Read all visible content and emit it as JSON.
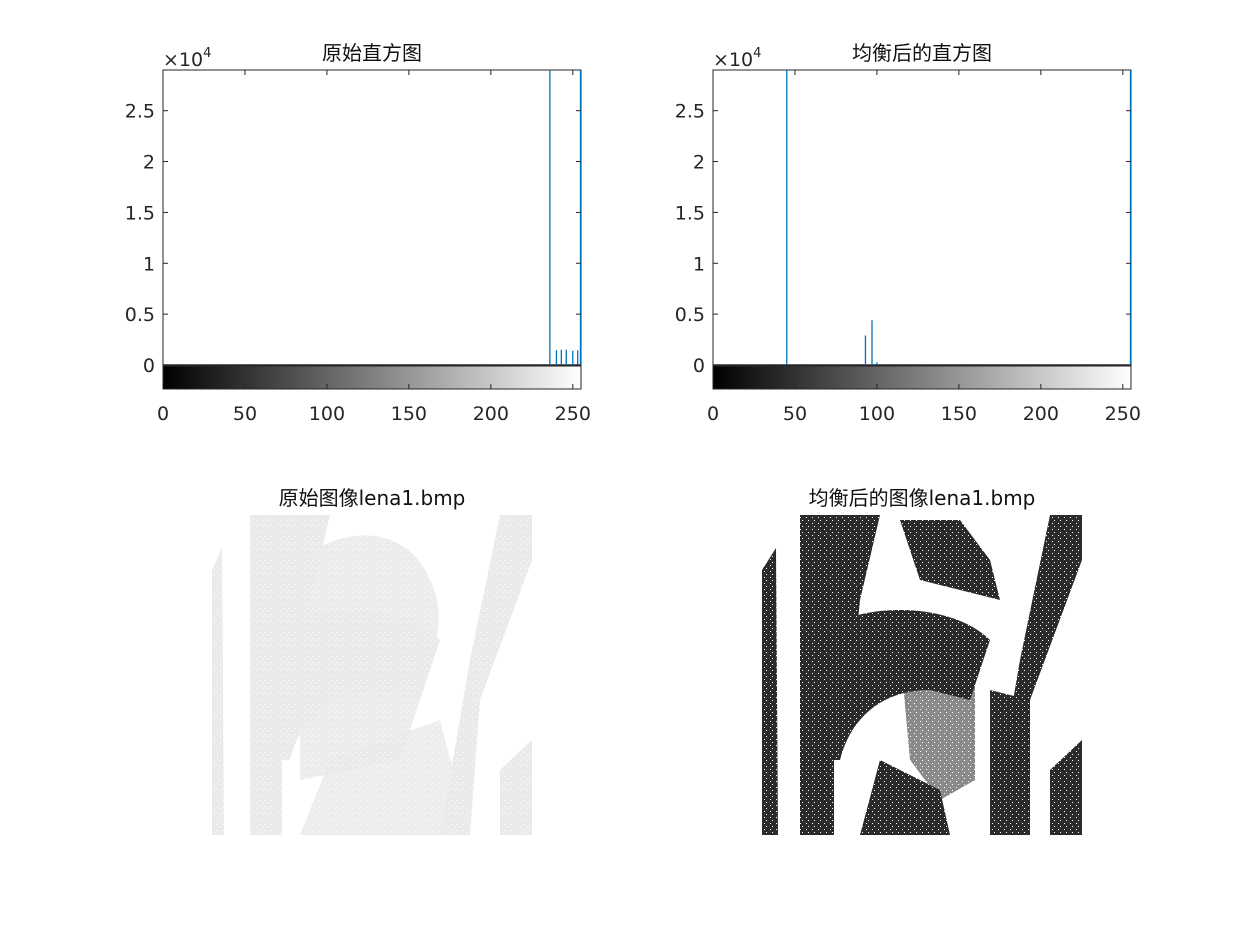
{
  "chart_data": [
    {
      "type": "bar",
      "title": "原始直方图",
      "xlabel": "",
      "ylabel": "",
      "xlim": [
        0,
        255
      ],
      "ylim": [
        0,
        29000
      ],
      "xticks": [
        "0",
        "50",
        "100",
        "150",
        "200",
        "250"
      ],
      "yticks": [
        "0",
        "0.5",
        "1",
        "1.5",
        "2",
        "2.5"
      ],
      "y_exponent": "×10",
      "y_exponent_power": "4",
      "grid": false,
      "colorbar": "gray",
      "bars": [
        {
          "x": 236,
          "y": 29000
        },
        {
          "x": 240,
          "y": 1450
        },
        {
          "x": 243,
          "y": 1500
        },
        {
          "x": 246,
          "y": 1500
        },
        {
          "x": 250,
          "y": 1400
        },
        {
          "x": 253,
          "y": 1450
        },
        {
          "x": 255,
          "y": 29000
        }
      ]
    },
    {
      "type": "bar",
      "title": "均衡后的直方图",
      "xlabel": "",
      "ylabel": "",
      "xlim": [
        0,
        255
      ],
      "ylim": [
        0,
        29000
      ],
      "xticks": [
        "0",
        "50",
        "100",
        "150",
        "200",
        "250"
      ],
      "yticks": [
        "0",
        "0.5",
        "1",
        "1.5",
        "2",
        "2.5"
      ],
      "y_exponent": "×10",
      "y_exponent_power": "4",
      "grid": false,
      "colorbar": "gray",
      "bars": [
        {
          "x": 45,
          "y": 29000
        },
        {
          "x": 93,
          "y": 2900
        },
        {
          "x": 97,
          "y": 4400
        },
        {
          "x": 100,
          "y": 250
        },
        {
          "x": 255,
          "y": 29000
        }
      ]
    }
  ],
  "images": [
    {
      "title": "原始图像lena1.bmp",
      "tone": "low-contrast light gray"
    },
    {
      "title": "均衡后的图像lena1.bmp",
      "tone": "high-contrast black and white"
    }
  ],
  "colors": {
    "bar": "#0072BD",
    "axis": "#262626",
    "orig_image_fg": "#e6e6e6",
    "eq_image_fg": "#2b2b2b"
  }
}
